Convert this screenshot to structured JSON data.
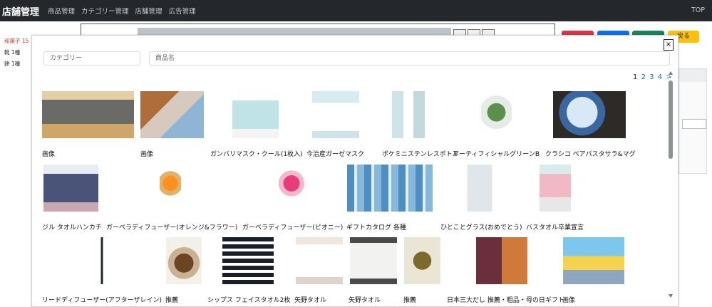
{
  "navbar": {
    "brand": "店舗管理",
    "links": [
      "商品管理",
      "カテゴリー管理",
      "店舗管理",
      "広告管理"
    ],
    "right": "TOP"
  },
  "background": {
    "list": [
      "和菓子 15",
      "靴  1種",
      "餅  1種"
    ],
    "buttons": [
      {
        "label": "",
        "color": "#dc3545"
      },
      {
        "label": "",
        "color": "#0d6efd"
      },
      {
        "label": "",
        "color": "#198754"
      },
      {
        "label": "戻る",
        "color": "#ffc107"
      }
    ]
  },
  "modal": {
    "close_label": "×",
    "category_placeholder": "カテゴリー",
    "name_placeholder": "商品名",
    "pages": [
      "1",
      "2",
      "3",
      "4"
    ],
    "next_label": ">",
    "products": [
      {
        "name": "画像",
        "img": "tray"
      },
      {
        "name": "画像",
        "img": "room"
      },
      {
        "name": "ガンバリマスク・クール(1枚入)",
        "img": "mask-blue"
      },
      {
        "name": "今治産ガーゼマスク",
        "img": "mask-white"
      },
      {
        "name": "ポケミニステンレスボトル",
        "img": "bottle"
      },
      {
        "name": "アーティフィシャルグリーンB",
        "img": "plant"
      },
      {
        "name": "クラシコ ペアパスタサラ&マグ",
        "img": "plates"
      },
      {
        "name": "ジル タオルハンカチ",
        "img": "towel-blue"
      },
      {
        "name": "ガーベラディフューザー(オレンジ&フラワー)",
        "img": "flower-orange"
      },
      {
        "name": "ガーベラディフューザー(ピオニー)",
        "img": "flower-pink"
      },
      {
        "name": "ギフトカタログ 各種",
        "img": "catalog"
      },
      {
        "name": "ひとことグラス(おめでとう)",
        "img": "glass"
      },
      {
        "name": "バスタオル卒業宣言",
        "img": "bath-towel"
      },
      {
        "name": "リードディフューザー(アフターザレイン)",
        "img": "reed"
      },
      {
        "name": "推薦",
        "img": "shiitake"
      },
      {
        "name": "シップス フェイスタオル2枚",
        "img": "ships"
      },
      {
        "name": "矢野タオル",
        "img": "towel-box"
      },
      {
        "name": "矢野タオル",
        "img": "towel-box2"
      },
      {
        "name": "推薦",
        "img": "box-green"
      },
      {
        "name": "日本三大だし 推薦・粗品・母の日ギフト",
        "img": "dashi"
      },
      {
        "name": "画像",
        "img": "popup"
      }
    ]
  }
}
